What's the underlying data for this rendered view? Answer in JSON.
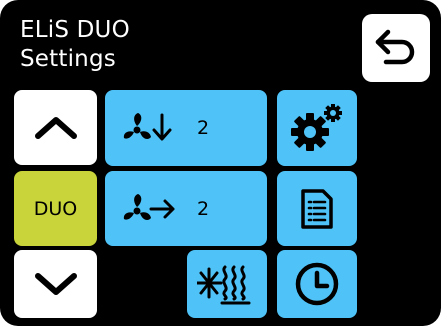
{
  "header": {
    "device_name": "ELiS DUO",
    "page_name": "Settings"
  },
  "nav": {
    "mode_label": "DUO"
  },
  "ventilation": {
    "supply_level": "2",
    "exhaust_level": "2"
  },
  "colors": {
    "background": "#000000",
    "tile_blue": "#4fc3f7",
    "tile_white": "#ffffff",
    "tile_active": "#c8d43a"
  },
  "icons": [
    "back-arrow-icon",
    "chevron-up-icon",
    "chevron-down-icon",
    "fan-down-icon",
    "fan-right-icon",
    "gears-icon",
    "document-icon",
    "heat-exchanger-icon",
    "clock-icon"
  ]
}
